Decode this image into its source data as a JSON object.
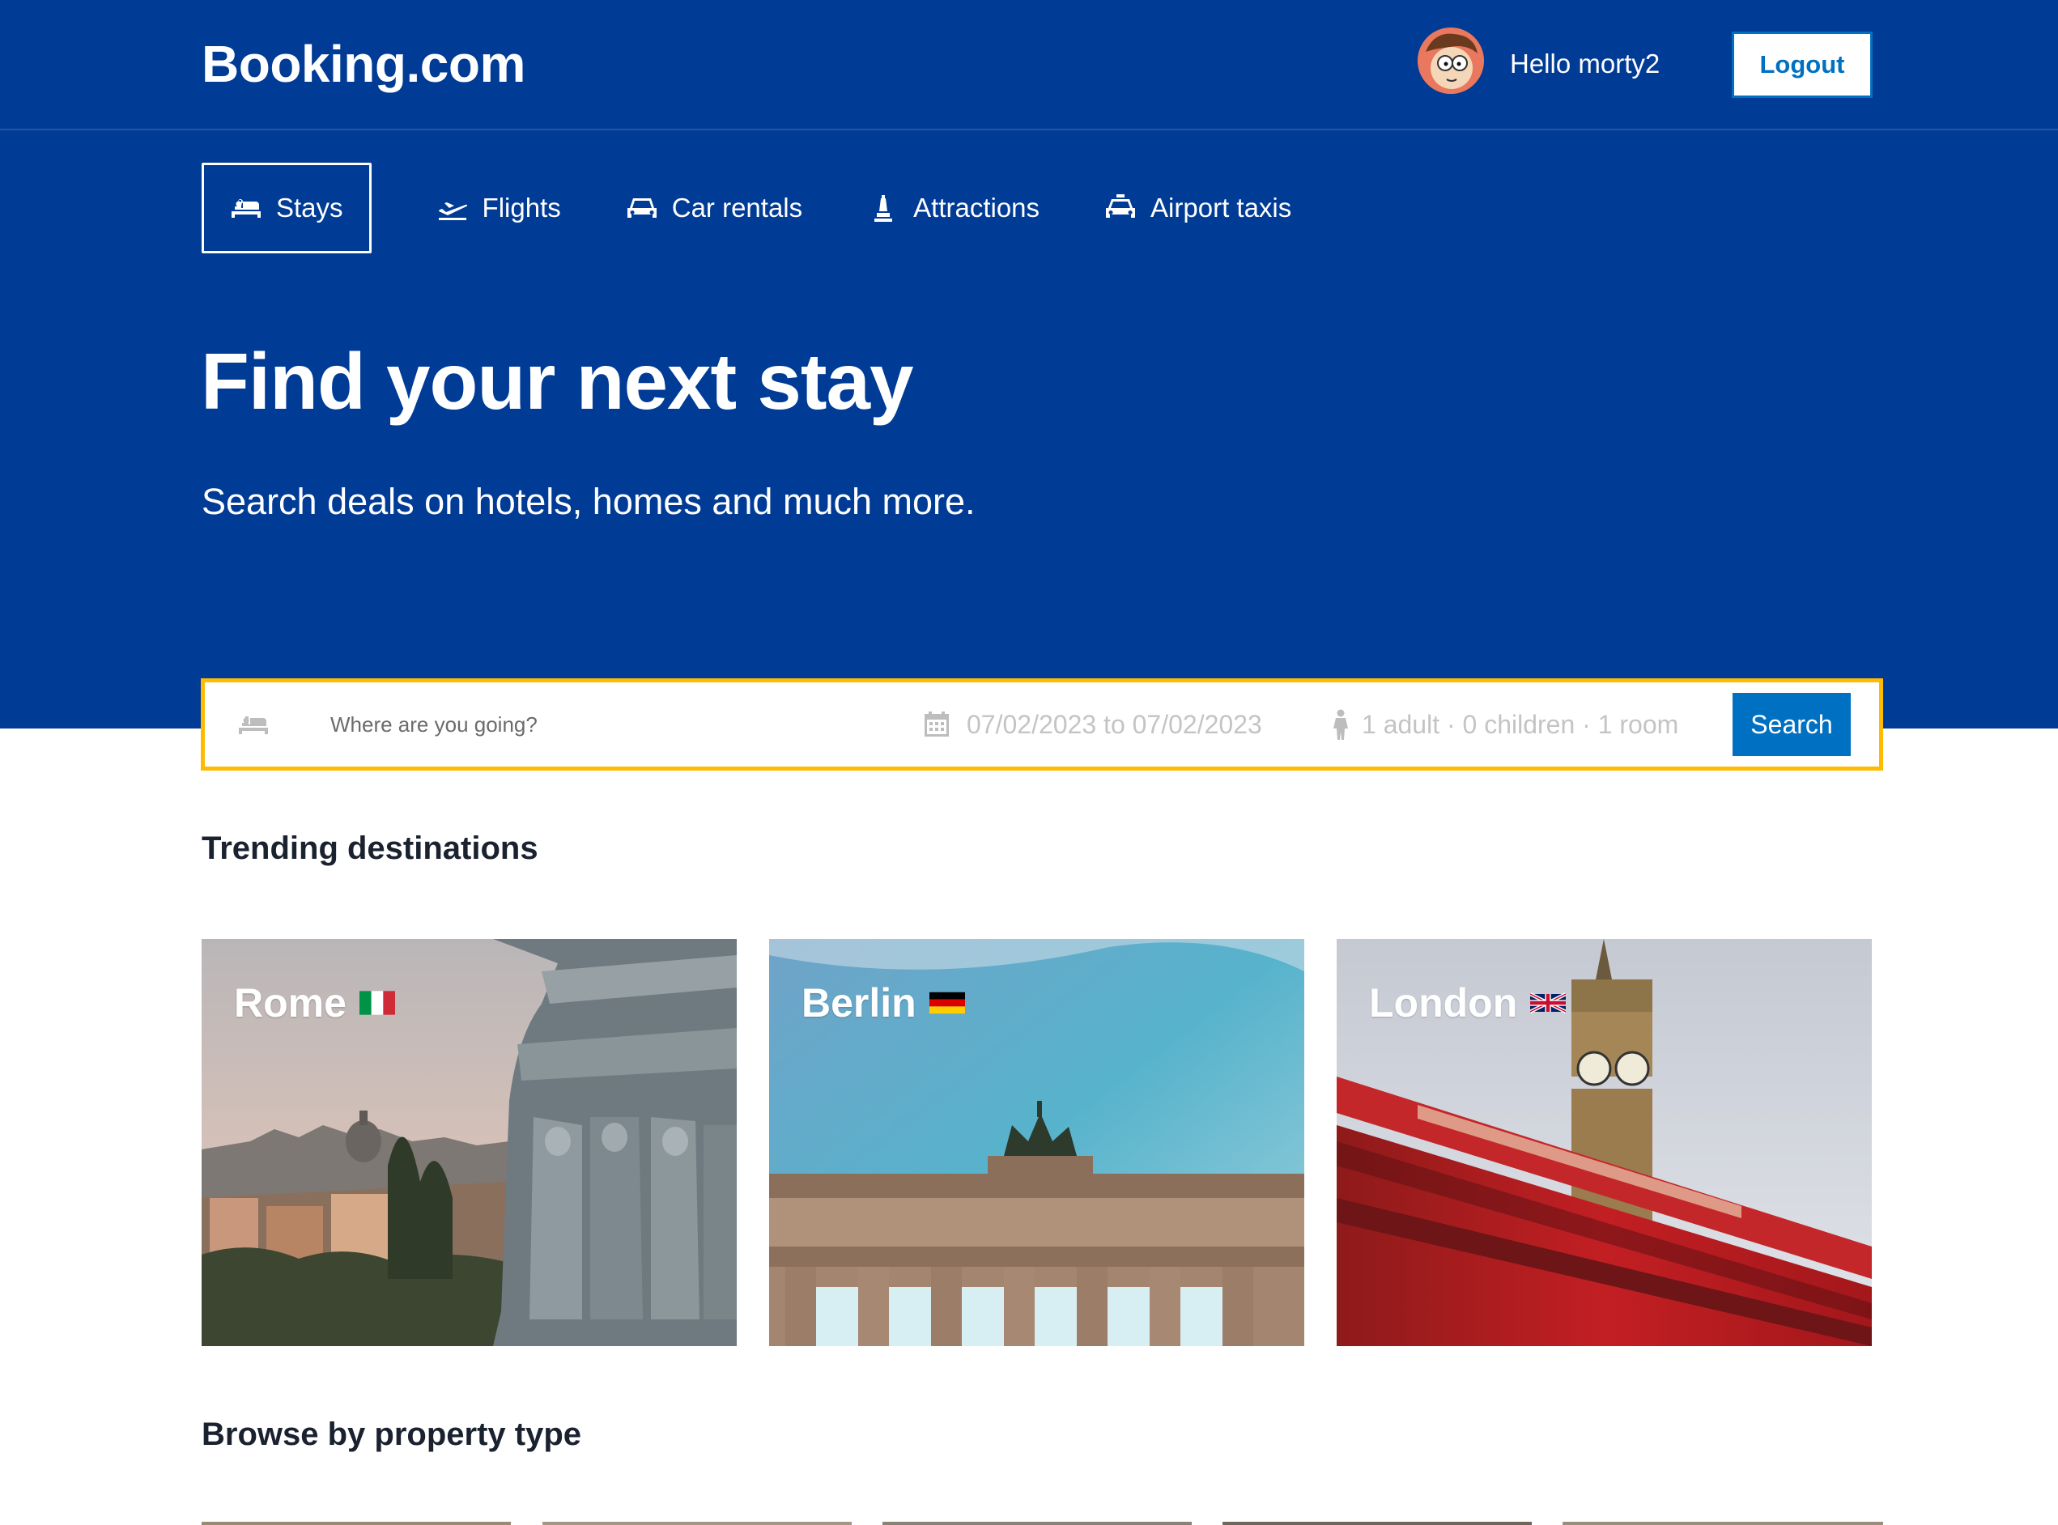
{
  "header": {
    "logo": "Booking.com",
    "greeting": "Hello morty2",
    "logout_label": "Logout"
  },
  "nav": {
    "items": [
      {
        "label": "Stays",
        "icon": "bed-icon",
        "active": true
      },
      {
        "label": "Flights",
        "icon": "plane-icon",
        "active": false
      },
      {
        "label": "Car rentals",
        "icon": "car-icon",
        "active": false
      },
      {
        "label": "Attractions",
        "icon": "attraction-icon",
        "active": false
      },
      {
        "label": "Airport taxis",
        "icon": "taxi-icon",
        "active": false
      }
    ]
  },
  "hero": {
    "title": "Find your next stay",
    "subtitle": "Search deals on hotels, homes and much more."
  },
  "search": {
    "destination_placeholder": "Where are you going?",
    "dates": "07/02/2023 to 07/02/2023",
    "guests": "1 adult · 0 children · 1 room",
    "button_label": "Search"
  },
  "trending": {
    "title": "Trending destinations",
    "cards": [
      {
        "city": "Rome",
        "flag": "italy-flag"
      },
      {
        "city": "Berlin",
        "flag": "germany-flag"
      },
      {
        "city": "London",
        "flag": "uk-flag"
      }
    ]
  },
  "browse": {
    "title": "Browse by property type"
  },
  "colors": {
    "brand_blue": "#003b95",
    "action_blue": "#0071c2",
    "search_border": "#febb02"
  }
}
